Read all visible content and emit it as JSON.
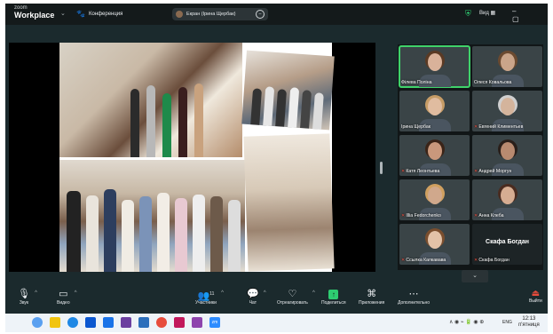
{
  "window": {
    "app_small": "zoom",
    "app_name": "Workplace",
    "meeting_label": "Конференция",
    "speaker_pill": "Екран (Ірина Щербак)",
    "view_label": "Вид"
  },
  "gallery": [
    {
      "name": "Філева Поліна",
      "active": true,
      "muted": false,
      "hair": "#5a3a24"
    },
    {
      "name": "Олеся Ковальова",
      "active": false,
      "muted": false,
      "hair": "#6b4a30"
    },
    {
      "name": "Ірина Щербак",
      "active": false,
      "muted": false,
      "hair": "#c69c66"
    },
    {
      "name": "Евгений Климентьев",
      "active": false,
      "muted": true,
      "hair": "#cfcfcf"
    },
    {
      "name": "Катя Леонтьева",
      "active": false,
      "muted": true,
      "hair": "#3a2418"
    },
    {
      "name": "Андрей Моргун",
      "active": false,
      "muted": true,
      "hair": "#2a1f1a"
    },
    {
      "name": "Illia Fedorchenko",
      "active": false,
      "muted": true,
      "hair": "#d0a060"
    },
    {
      "name": "Анна Клеба",
      "active": false,
      "muted": true,
      "hair": "#4a2c20"
    },
    {
      "name": "Ссылка Капкавава",
      "active": false,
      "muted": true,
      "hair": "#7a4e2e"
    },
    {
      "name": "Скафа Богдан",
      "active": false,
      "muted": true,
      "big_name": "Скафа Богдан"
    }
  ],
  "toolbar": {
    "audio": "Звук",
    "video": "Видео",
    "participants": "Участники",
    "participants_count": "11",
    "chat": "Чат",
    "react": "Отреагировать",
    "share": "Поделиться",
    "apps": "Приложения",
    "more": "Дополнительно",
    "leave": "Выйти"
  },
  "taskbar": {
    "lang": "ENG",
    "time": "12:13",
    "day": "п'ятниця"
  },
  "colors": {
    "accent_green": "#2ecc71",
    "muted_red": "#e74c3c",
    "active_outline": "#3fd36a"
  }
}
